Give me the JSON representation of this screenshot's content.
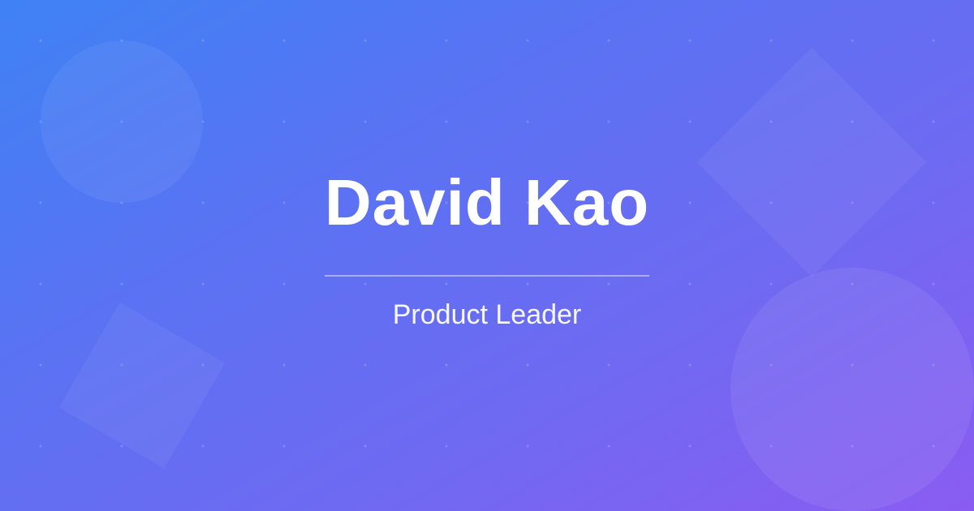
{
  "profile": {
    "name": "David Kao",
    "role": "Product Leader"
  },
  "colors": {
    "gradient_start": "#3f82f5",
    "gradient_mid": "#6e6af2",
    "gradient_end": "#8a5cf1",
    "text": "#ffffff"
  }
}
